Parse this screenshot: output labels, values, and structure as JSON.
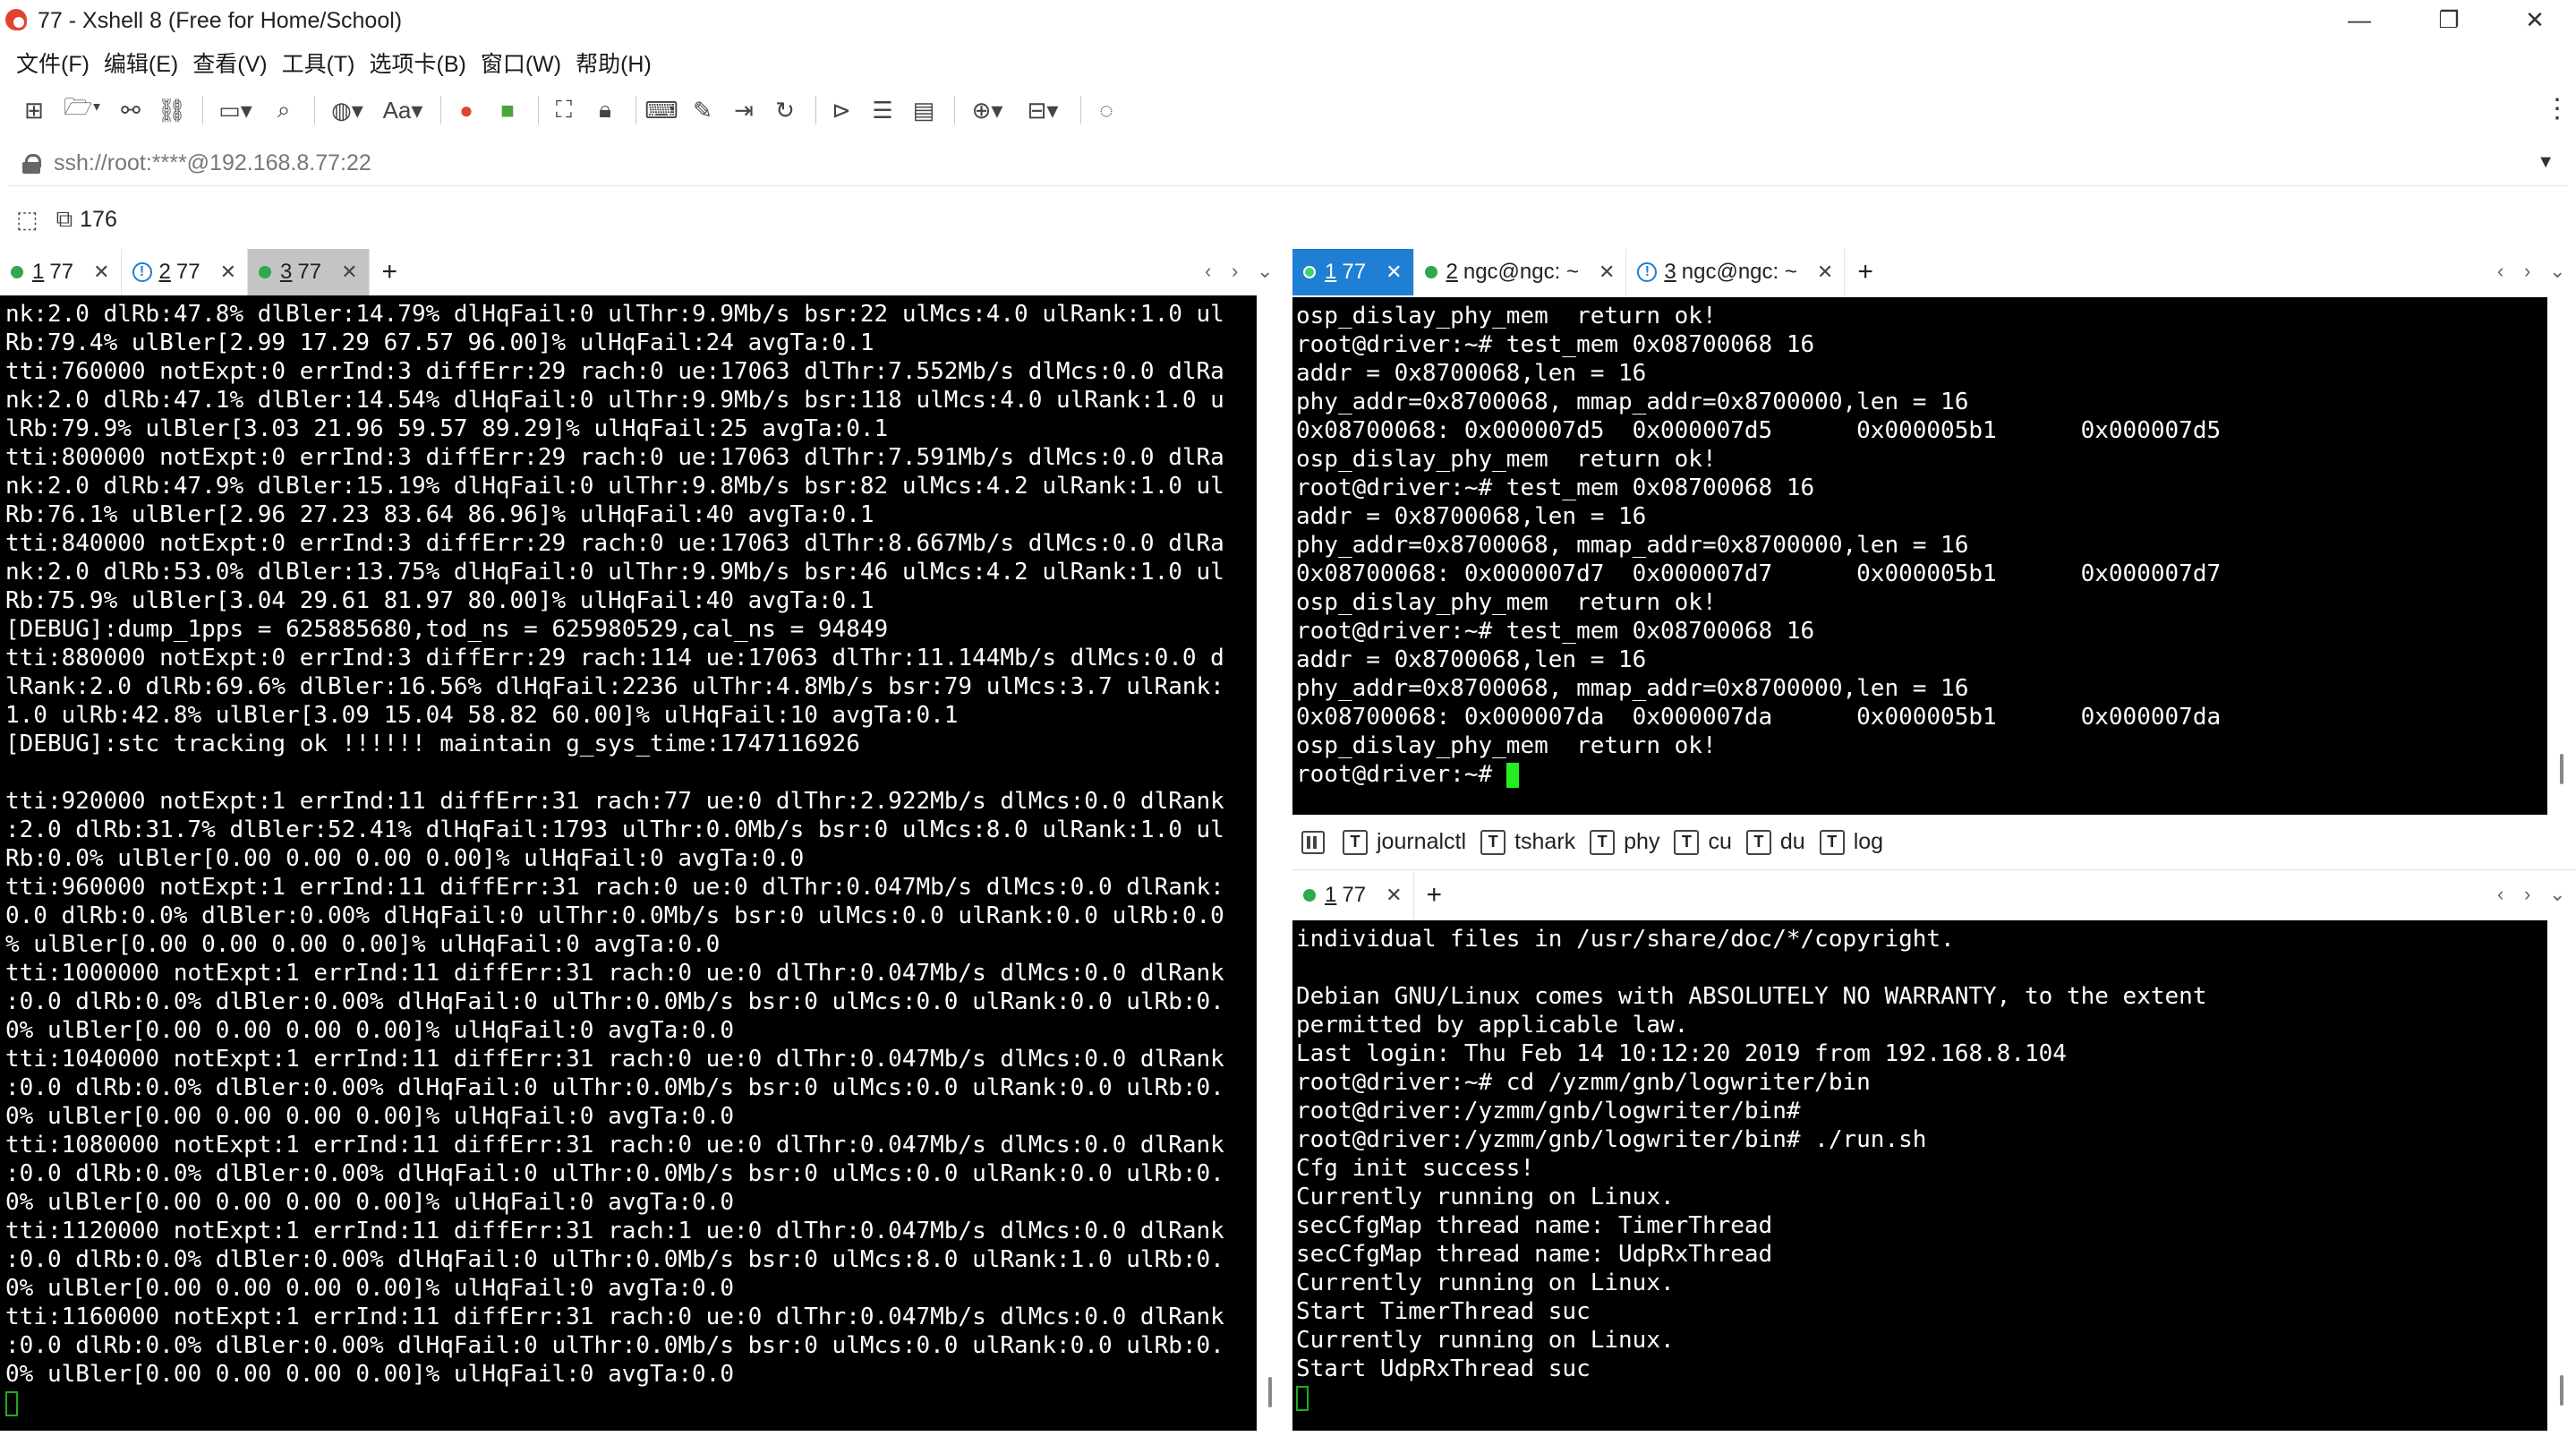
{
  "window": {
    "title": "77 - Xshell 8 (Free for Home/School)",
    "minimize": "—",
    "restore": "❐",
    "close": "✕"
  },
  "menu": [
    "文件(F)",
    "编辑(E)",
    "查看(V)",
    "工具(T)",
    "选项卡(B)",
    "窗口(W)",
    "帮助(H)"
  ],
  "address": {
    "value": "ssh://root:****@192.168.8.77:22"
  },
  "session_bar": {
    "count": "176"
  },
  "left_tabs": [
    {
      "num": "1",
      "label": "77",
      "status": "connected"
    },
    {
      "num": "2",
      "label": "77",
      "status": "warning"
    },
    {
      "num": "3",
      "label": "77",
      "status": "connected"
    }
  ],
  "right_top_tabs": [
    {
      "num": "1",
      "label": "77",
      "status": "connected"
    },
    {
      "num": "2",
      "label": "ngc@ngc: ~",
      "status": "connected"
    },
    {
      "num": "3",
      "label": "ngc@ngc: ~",
      "status": "warning"
    }
  ],
  "right_bottom_tabs": [
    {
      "num": "1",
      "label": "77",
      "status": "connected"
    }
  ],
  "quick_commands": [
    "journalctl",
    "tshark",
    "phy",
    "cu",
    "du",
    "log"
  ],
  "left_terminal": [
    "nk:2.0 dlRb:47.8% dlBler:14.79% dlHqFail:0 ulThr:9.9Mb/s bsr:22 ulMcs:4.0 ulRank:1.0 ul",
    "Rb:79.4% ulBler[2.99 17.29 67.57 96.00]% ulHqFail:24 avgTa:0.1",
    "tti:760000 notExpt:0 errInd:3 diffErr:29 rach:0 ue:17063 dlThr:7.552Mb/s dlMcs:0.0 dlRa",
    "nk:2.0 dlRb:47.1% dlBler:14.54% dlHqFail:0 ulThr:9.9Mb/s bsr:118 ulMcs:4.0 ulRank:1.0 u",
    "lRb:79.9% ulBler[3.03 21.96 59.57 89.29]% ulHqFail:25 avgTa:0.1",
    "tti:800000 notExpt:0 errInd:3 diffErr:29 rach:0 ue:17063 dlThr:7.591Mb/s dlMcs:0.0 dlRa",
    "nk:2.0 dlRb:47.9% dlBler:15.19% dlHqFail:0 ulThr:9.8Mb/s bsr:82 ulMcs:4.2 ulRank:1.0 ul",
    "Rb:76.1% ulBler[2.96 27.23 83.64 86.96]% ulHqFail:40 avgTa:0.1",
    "tti:840000 notExpt:0 errInd:3 diffErr:29 rach:0 ue:17063 dlThr:8.667Mb/s dlMcs:0.0 dlRa",
    "nk:2.0 dlRb:53.0% dlBler:13.75% dlHqFail:0 ulThr:9.9Mb/s bsr:46 ulMcs:4.2 ulRank:1.0 ul",
    "Rb:75.9% ulBler[3.04 29.61 81.97 80.00]% ulHqFail:40 avgTa:0.1",
    "[DEBUG]:dump_1pps = 625885680,tod_ns = 625980529,cal_ns = 94849",
    "tti:880000 notExpt:0 errInd:3 diffErr:29 rach:114 ue:17063 dlThr:11.144Mb/s dlMcs:0.0 d",
    "lRank:2.0 dlRb:69.6% dlBler:16.56% dlHqFail:2236 ulThr:4.8Mb/s bsr:79 ulMcs:3.7 ulRank:",
    "1.0 ulRb:42.8% ulBler[3.09 15.04 58.82 60.00]% ulHqFail:10 avgTa:0.1",
    "[DEBUG]:stc tracking ok !!!!!! maintain g_sys_time:1747116926",
    "",
    "tti:920000 notExpt:1 errInd:11 diffErr:31 rach:77 ue:0 dlThr:2.922Mb/s dlMcs:0.0 dlRank",
    ":2.0 dlRb:31.7% dlBler:52.41% dlHqFail:1793 ulThr:0.0Mb/s bsr:0 ulMcs:8.0 ulRank:1.0 ul",
    "Rb:0.0% ulBler[0.00 0.00 0.00 0.00]% ulHqFail:0 avgTa:0.0",
    "tti:960000 notExpt:1 errInd:11 diffErr:31 rach:0 ue:0 dlThr:0.047Mb/s dlMcs:0.0 dlRank:",
    "0.0 dlRb:0.0% dlBler:0.00% dlHqFail:0 ulThr:0.0Mb/s bsr:0 ulMcs:0.0 ulRank:0.0 ulRb:0.0",
    "% ulBler[0.00 0.00 0.00 0.00]% ulHqFail:0 avgTa:0.0",
    "tti:1000000 notExpt:1 errInd:11 diffErr:31 rach:0 ue:0 dlThr:0.047Mb/s dlMcs:0.0 dlRank",
    ":0.0 dlRb:0.0% dlBler:0.00% dlHqFail:0 ulThr:0.0Mb/s bsr:0 ulMcs:0.0 ulRank:0.0 ulRb:0.",
    "0% ulBler[0.00 0.00 0.00 0.00]% ulHqFail:0 avgTa:0.0",
    "tti:1040000 notExpt:1 errInd:11 diffErr:31 rach:0 ue:0 dlThr:0.047Mb/s dlMcs:0.0 dlRank",
    ":0.0 dlRb:0.0% dlBler:0.00% dlHqFail:0 ulThr:0.0Mb/s bsr:0 ulMcs:0.0 ulRank:0.0 ulRb:0.",
    "0% ulBler[0.00 0.00 0.00 0.00]% ulHqFail:0 avgTa:0.0",
    "tti:1080000 notExpt:1 errInd:11 diffErr:31 rach:0 ue:0 dlThr:0.047Mb/s dlMcs:0.0 dlRank",
    ":0.0 dlRb:0.0% dlBler:0.00% dlHqFail:0 ulThr:0.0Mb/s bsr:0 ulMcs:0.0 ulRank:0.0 ulRb:0.",
    "0% ulBler[0.00 0.00 0.00 0.00]% ulHqFail:0 avgTa:0.0",
    "tti:1120000 notExpt:1 errInd:11 diffErr:31 rach:1 ue:0 dlThr:0.047Mb/s dlMcs:0.0 dlRank",
    ":0.0 dlRb:0.0% dlBler:0.00% dlHqFail:0 ulThr:0.0Mb/s bsr:0 ulMcs:8.0 ulRank:1.0 ulRb:0.",
    "0% ulBler[0.00 0.00 0.00 0.00]% ulHqFail:0 avgTa:0.0",
    "tti:1160000 notExpt:1 errInd:11 diffErr:31 rach:0 ue:0 dlThr:0.047Mb/s dlMcs:0.0 dlRank",
    ":0.0 dlRb:0.0% dlBler:0.00% dlHqFail:0 ulThr:0.0Mb/s bsr:0 ulMcs:0.0 ulRank:0.0 ulRb:0.",
    "0% ulBler[0.00 0.00 0.00 0.00]% ulHqFail:0 avgTa:0.0"
  ],
  "right_top_terminal": [
    "osp_dislay_phy_mem  return ok!",
    "root@driver:~# test_mem 0x08700068 16",
    "addr = 0x8700068,len = 16",
    "phy_addr=0x8700068, mmap_addr=0x8700000,len = 16",
    "0x08700068: 0x000007d5  0x000007d5      0x000005b1      0x000007d5",
    "osp_dislay_phy_mem  return ok!",
    "root@driver:~# test_mem 0x08700068 16",
    "addr = 0x8700068,len = 16",
    "phy_addr=0x8700068, mmap_addr=0x8700000,len = 16",
    "0x08700068: 0x000007d7  0x000007d7      0x000005b1      0x000007d7",
    "osp_dislay_phy_mem  return ok!",
    "root@driver:~# test_mem 0x08700068 16",
    "addr = 0x8700068,len = 16",
    "phy_addr=0x8700068, mmap_addr=0x8700000,len = 16",
    "0x08700068: 0x000007da  0x000007da      0x000005b1      0x000007da",
    "osp_dislay_phy_mem  return ok!"
  ],
  "right_top_prompt": "root@driver:~# ",
  "right_bottom_terminal": [
    "individual files in /usr/share/doc/*/copyright.",
    "",
    "Debian GNU/Linux comes with ABSOLUTELY NO WARRANTY, to the extent",
    "permitted by applicable law.",
    "Last login: Thu Feb 14 10:12:20 2019 from 192.168.8.104",
    "root@driver:~# cd /yzmm/gnb/logwriter/bin",
    "root@driver:/yzmm/gnb/logwriter/bin#",
    "root@driver:/yzmm/gnb/logwriter/bin# ./run.sh",
    "Cfg init success!",
    "Currently running on Linux.",
    "secCfgMap thread name: TimerThread",
    "secCfgMap thread name: UdpRxThread",
    "Currently running on Linux.",
    "Start TimerThread suc",
    "Currently running on Linux.",
    "Start UdpRxThread suc"
  ],
  "colors": {
    "accent_tab": "#1e7fd4",
    "terminal_bg": "#000000",
    "terminal_fg": "#ffffff",
    "cursor": "#22ee22"
  }
}
